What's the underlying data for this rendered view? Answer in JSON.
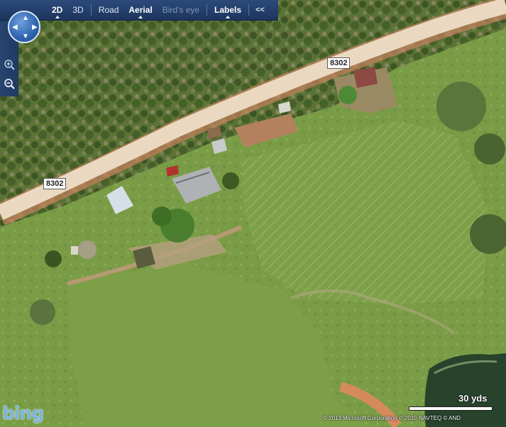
{
  "toolbar": {
    "items": [
      {
        "label": "2D",
        "bold": true,
        "selected": true
      },
      {
        "label": "3D"
      },
      {
        "label": "Road"
      },
      {
        "label": "Aerial",
        "bold": true,
        "selected": true
      },
      {
        "label": "Bird's eye",
        "disabled": true
      },
      {
        "label": "Labels",
        "bold": true,
        "selected": true
      }
    ],
    "collapse_label": "<<"
  },
  "navigation": {
    "compass_icon": "compass-pan-icon",
    "zoom_in_icon": "zoom-in-icon",
    "zoom_out_icon": "zoom-out-icon"
  },
  "map": {
    "view": "Aerial",
    "road_labels": [
      "8302",
      "8302"
    ],
    "scale_label": "30 yds",
    "copyright": "© 2013 Microsoft Corporation   © 2010 NAVTEQ   © AND",
    "logo_text": "bing",
    "colors": {
      "toolbar": "#1f3a63",
      "road": "#e8d9c2",
      "grass": "#7a9a45",
      "forest": "#4d6a2e",
      "water": "#2e4a2a",
      "logo": "#7bb6df"
    }
  }
}
